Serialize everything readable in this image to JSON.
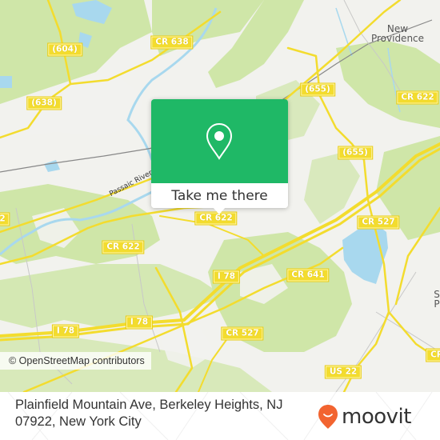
{
  "map": {
    "colors": {
      "background": "#f2f2ee",
      "woods": "#cfe6a8",
      "water": "#a8d8ee",
      "road": "#f3dc2e",
      "rail": "#888888"
    },
    "road_shields": [
      {
        "id": "604",
        "label": "(604)"
      },
      {
        "id": "cr638",
        "label": "CR 638"
      },
      {
        "id": "638",
        "label": "(638)"
      },
      {
        "id": "655a",
        "label": "(655)"
      },
      {
        "id": "cr622a",
        "label": "CR 622"
      },
      {
        "id": "655b",
        "label": "(655)"
      },
      {
        "id": "cr622b",
        "label": "CR 622"
      },
      {
        "id": "cr622c",
        "label": "CR 622"
      },
      {
        "id": "cr622d",
        "label": "2"
      },
      {
        "id": "cr527a",
        "label": "CR 527"
      },
      {
        "id": "cr641",
        "label": "CR 641"
      },
      {
        "id": "i78a",
        "label": "I 78"
      },
      {
        "id": "i78b",
        "label": "I 78"
      },
      {
        "id": "i78c",
        "label": "I 78"
      },
      {
        "id": "cr527b",
        "label": "CR 527"
      },
      {
        "id": "us22",
        "label": "US 22"
      },
      {
        "id": "cr-edge",
        "label": "CR"
      }
    ],
    "places": [
      {
        "id": "new-providence",
        "label_line1": "New",
        "label_line2": "Providence"
      },
      {
        "id": "edge-place",
        "label_line1": "S",
        "label_line2": "P"
      }
    ],
    "river_label": "Passaic River",
    "attribution": "© OpenStreetMap contributors"
  },
  "popup": {
    "icon": "map-pin-icon",
    "button_label": "Take me there",
    "color": "#1fb866"
  },
  "footer": {
    "address": "Plainfield Mountain Ave, Berkeley Heights, NJ 07922, New York City",
    "brand": "moovit",
    "brand_color": "#f26430"
  }
}
